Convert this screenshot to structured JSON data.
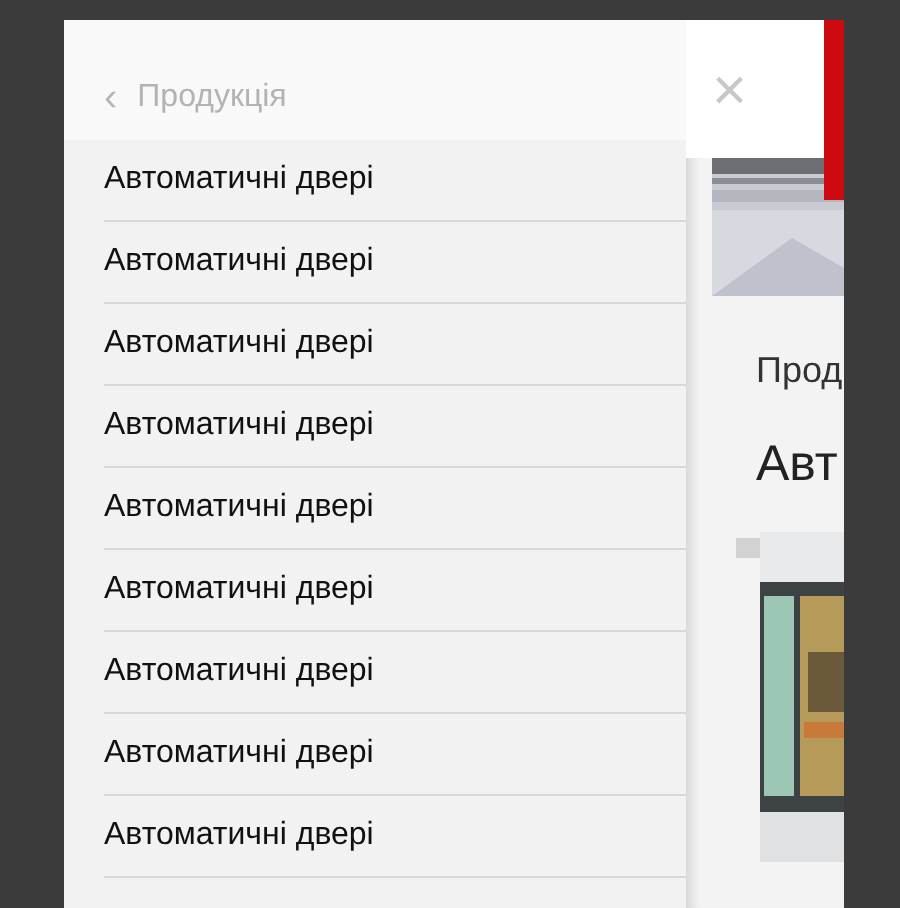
{
  "menu": {
    "back_icon": "‹",
    "title": "Продукція",
    "items": [
      {
        "label": "Автоматичні двері"
      },
      {
        "label": "Автоматичні двері"
      },
      {
        "label": "Автоматичні двері"
      },
      {
        "label": "Автоматичні двері"
      },
      {
        "label": "Автоматичні двері"
      },
      {
        "label": "Автоматичні двері"
      },
      {
        "label": "Автоматичні двері"
      },
      {
        "label": "Автоматичні двері"
      },
      {
        "label": "Автоматичні двері"
      }
    ]
  },
  "page": {
    "close": "×",
    "breadcrumb": "Прод",
    "heading": "Авт"
  }
}
